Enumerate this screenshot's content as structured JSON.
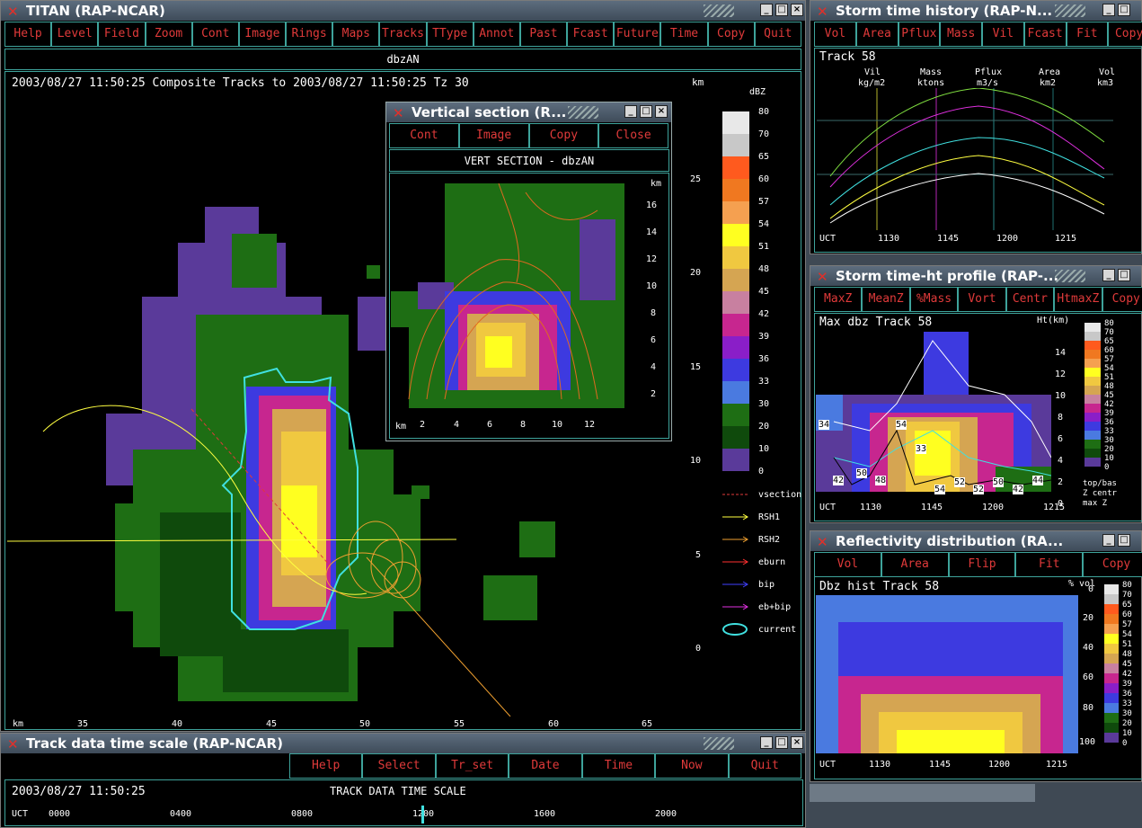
{
  "titan": {
    "title": "TITAN (RAP-NCAR)",
    "menu": [
      "Help",
      "Level",
      "Field",
      "Zoom",
      "Cont",
      "Image",
      "Rings",
      "Maps",
      "Tracks",
      "TType",
      "Annot",
      "Past",
      "Fcast",
      "Future",
      "Time",
      "Copy",
      "Quit"
    ],
    "field_label": "dbzAN",
    "header": "2003/08/27 11:50:25  Composite Tracks to 2003/08/27 11:50:25 Tz 30",
    "km_label": "km",
    "dbz_unit": "dBZ",
    "color_scale": [
      "80",
      "70",
      "65",
      "60",
      "57",
      "54",
      "51",
      "48",
      "45",
      "42",
      "39",
      "36",
      "33",
      "30",
      "20",
      "10",
      "0"
    ],
    "y_ticks": [
      "25",
      "20",
      "15",
      "10",
      "5",
      "0"
    ],
    "x_ticks": [
      "35",
      "40",
      "45",
      "50",
      "55",
      "60",
      "65"
    ],
    "x_unit": "km",
    "legend": [
      {
        "label": "vsection",
        "color": "#e03a3a"
      },
      {
        "label": "RSH1",
        "color": "#ffff40"
      },
      {
        "label": "RSH2",
        "color": "#f0a030"
      },
      {
        "label": "eburn",
        "color": "#ff3030"
      },
      {
        "label": "bip",
        "color": "#4040ff"
      },
      {
        "label": "eb+bip",
        "color": "#e030e0"
      },
      {
        "label": "current",
        "color": "#40e0e0"
      }
    ]
  },
  "vsection": {
    "title": "Vertical section (R...",
    "menu": [
      "Cont",
      "Image",
      "Copy",
      "Close"
    ],
    "header": "VERT SECTION - dbzAN",
    "y_unit": "km",
    "y_ticks": [
      "16",
      "14",
      "12",
      "10",
      "8",
      "6",
      "4",
      "2"
    ],
    "x_unit": "km",
    "x_ticks": [
      "2",
      "4",
      "6",
      "8",
      "10",
      "12"
    ]
  },
  "history": {
    "title": "Storm time history (RAP-N...",
    "menu": [
      "Vol",
      "Area",
      "Pflux",
      "Mass",
      "Vil",
      "Fcast",
      "Fit",
      "Copy"
    ],
    "track": "Track 58",
    "columns": [
      {
        "name": "Vil",
        "unit": "kg/m2"
      },
      {
        "name": "Mass",
        "unit": "ktons"
      },
      {
        "name": "Pflux",
        "unit": "m3/s"
      },
      {
        "name": "Area",
        "unit": "km2"
      },
      {
        "name": "Vol",
        "unit": "km3"
      }
    ],
    "uct": "UCT",
    "times": [
      "1130",
      "1145",
      "1200",
      "1215"
    ]
  },
  "profile": {
    "title": "Storm time-ht profile (RAP-...",
    "menu": [
      "MaxZ",
      "MeanZ",
      "%Mass",
      "Vort",
      "Centr",
      "HtmaxZ",
      "Copy"
    ],
    "label": "Max dbz  Track 58",
    "ht_unit": "Ht(km)",
    "ht_ticks": [
      "14",
      "12",
      "10",
      "8",
      "6",
      "4",
      "2",
      "0"
    ],
    "scale": [
      "80",
      "70",
      "65",
      "60",
      "57",
      "54",
      "51",
      "48",
      "45",
      "42",
      "39",
      "36",
      "33",
      "30",
      "20",
      "10",
      "0"
    ],
    "legend": [
      "top/bas",
      "Z centr",
      "max Z"
    ],
    "peak_labels": [
      "34",
      "50",
      "48",
      "54",
      "33",
      "54",
      "52",
      "52",
      "50",
      "42",
      "44",
      "42"
    ],
    "uct": "UCT",
    "times": [
      "1130",
      "1145",
      "1200",
      "1215"
    ]
  },
  "refl": {
    "title": "Reflectivity distribution (RA...",
    "menu": [
      "Vol",
      "Area",
      "Flip",
      "Fit",
      "Copy"
    ],
    "label": "Dbz hist Track 58",
    "pct_unit": "% vol",
    "pct_ticks": [
      "0",
      "20",
      "40",
      "60",
      "80",
      "100"
    ],
    "scale": [
      "80",
      "70",
      "65",
      "60",
      "57",
      "54",
      "51",
      "48",
      "45",
      "42",
      "39",
      "36",
      "33",
      "30",
      "20",
      "10",
      "0"
    ],
    "uct": "UCT",
    "times": [
      "1130",
      "1145",
      "1200",
      "1215"
    ]
  },
  "timescale": {
    "title": "Track data time scale (RAP-NCAR)",
    "menu": [
      "Help",
      "Select",
      "Tr_set",
      "Date",
      "Time",
      "Now",
      "Quit"
    ],
    "date": "2003/08/27 11:50:25",
    "header": "TRACK DATA TIME SCALE",
    "uct": "UCT",
    "ticks": [
      "0000",
      "0400",
      "0800",
      "1200",
      "1600",
      "2000"
    ]
  }
}
